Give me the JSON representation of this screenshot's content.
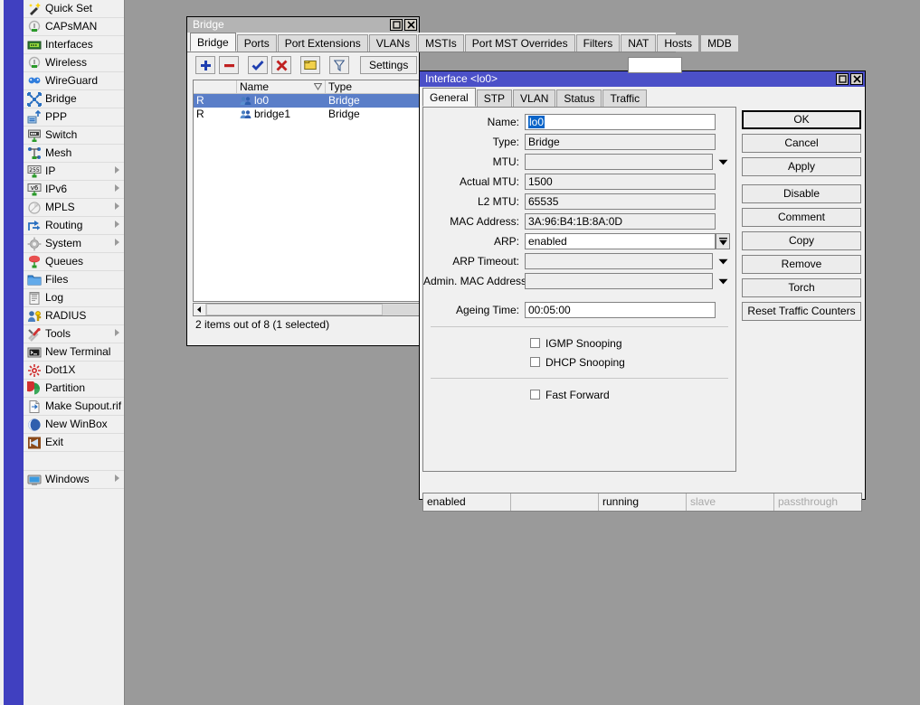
{
  "app": {
    "background_color": "#9a9a9a",
    "sidebar_stripe_color": "#4040c0",
    "accent_color": "#4b50c8"
  },
  "sidebar": {
    "items": [
      {
        "label": "Quick Set",
        "icon": "wand-icon",
        "submenu": false
      },
      {
        "label": "CAPsMAN",
        "icon": "antenna-icon",
        "submenu": false
      },
      {
        "label": "Interfaces",
        "icon": "nic-card-icon",
        "submenu": false
      },
      {
        "label": "Wireless",
        "icon": "antenna-icon",
        "submenu": false
      },
      {
        "label": "WireGuard",
        "icon": "wireguard-icon",
        "submenu": false
      },
      {
        "label": "Bridge",
        "icon": "bridge-icon",
        "submenu": false
      },
      {
        "label": "PPP",
        "icon": "ppp-icon",
        "submenu": false
      },
      {
        "label": "Switch",
        "icon": "switch-icon",
        "submenu": false
      },
      {
        "label": "Mesh",
        "icon": "mesh-icon",
        "submenu": false
      },
      {
        "label": "IP",
        "icon": "ip-255-icon",
        "submenu": true
      },
      {
        "label": "IPv6",
        "icon": "ipv6-icon",
        "submenu": true
      },
      {
        "label": "MPLS",
        "icon": "mpls-icon",
        "submenu": true
      },
      {
        "label": "Routing",
        "icon": "routing-icon",
        "submenu": true
      },
      {
        "label": "System",
        "icon": "gear-icon",
        "submenu": true
      },
      {
        "label": "Queues",
        "icon": "queues-icon",
        "submenu": false
      },
      {
        "label": "Files",
        "icon": "folder-icon",
        "submenu": false
      },
      {
        "label": "Log",
        "icon": "log-icon",
        "submenu": false
      },
      {
        "label": "RADIUS",
        "icon": "radius-key-icon",
        "submenu": false
      },
      {
        "label": "Tools",
        "icon": "tools-icon",
        "submenu": true
      },
      {
        "label": "New Terminal",
        "icon": "terminal-icon",
        "submenu": false
      },
      {
        "label": "Dot1X",
        "icon": "dot1x-icon",
        "submenu": false
      },
      {
        "label": "Partition",
        "icon": "partition-icon",
        "submenu": false
      },
      {
        "label": "Make Supout.rif",
        "icon": "document-icon",
        "submenu": false
      },
      {
        "label": "New WinBox",
        "icon": "winbox-icon",
        "submenu": false
      },
      {
        "label": "Exit",
        "icon": "exit-icon",
        "submenu": false
      }
    ],
    "footer_items": [
      {
        "label": "Windows",
        "icon": "monitor-icon",
        "submenu": true
      }
    ]
  },
  "bridge_window": {
    "title": "Bridge",
    "maximize_glyph": "❐",
    "close_glyph": "✕",
    "tabs": [
      {
        "label": "Bridge",
        "selected": true
      },
      {
        "label": "Ports",
        "selected": false
      },
      {
        "label": "Port Extensions",
        "selected": false
      },
      {
        "label": "VLANs",
        "selected": false
      },
      {
        "label": "MSTIs",
        "selected": false
      },
      {
        "label": "Port MST Overrides",
        "selected": false
      },
      {
        "label": "Filters",
        "selected": false
      },
      {
        "label": "NAT",
        "selected": false
      },
      {
        "label": "Hosts",
        "selected": false
      },
      {
        "label": "MDB",
        "selected": false
      }
    ],
    "toolbar": [
      {
        "name": "add-button",
        "icon": "plus-icon",
        "label": ""
      },
      {
        "name": "remove-button",
        "icon": "minus-icon",
        "label": ""
      },
      {
        "name": "enable-button",
        "icon": "check-icon",
        "label": ""
      },
      {
        "name": "disable-button",
        "icon": "x-red-icon",
        "label": ""
      },
      {
        "name": "comment-button",
        "icon": "note-icon",
        "label": ""
      },
      {
        "name": "filter-button",
        "icon": "funnel-icon",
        "label": ""
      },
      {
        "name": "settings-button",
        "icon": "",
        "label": "Settings"
      }
    ],
    "table": {
      "columns": [
        "",
        "Name",
        "Type"
      ],
      "sorted_column": "Name",
      "rows": [
        {
          "flag": "R",
          "name": "lo0",
          "type": "Bridge",
          "selected": true
        },
        {
          "flag": "R",
          "name": "bridge1",
          "type": "Bridge",
          "selected": false
        }
      ]
    },
    "status": "2 items out of 8 (1 selected)"
  },
  "interface_dialog": {
    "title": "Interface <lo0>",
    "maximize_glyph": "❐",
    "close_glyph": "✕",
    "tabs": [
      {
        "label": "General",
        "selected": true
      },
      {
        "label": "STP",
        "selected": false
      },
      {
        "label": "VLAN",
        "selected": false
      },
      {
        "label": "Status",
        "selected": false
      },
      {
        "label": "Traffic",
        "selected": false
      }
    ],
    "fields": [
      {
        "label": "Name:",
        "value": "lo0",
        "kind": "text-selected",
        "control": "none"
      },
      {
        "label": "Type:",
        "value": "Bridge",
        "kind": "readonly",
        "control": "none"
      },
      {
        "label": "MTU:",
        "value": "",
        "kind": "empty",
        "control": "arrow"
      },
      {
        "label": "Actual MTU:",
        "value": "1500",
        "kind": "readonly",
        "control": "none"
      },
      {
        "label": "L2 MTU:",
        "value": "65535",
        "kind": "readonly",
        "control": "none"
      },
      {
        "label": "MAC Address:",
        "value": "3A:96:B4:1B:8A:0D",
        "kind": "readonly",
        "control": "none"
      },
      {
        "label": "ARP:",
        "value": "enabled",
        "kind": "text",
        "control": "dropbtn"
      },
      {
        "label": "ARP Timeout:",
        "value": "",
        "kind": "empty",
        "control": "arrow"
      },
      {
        "label": "Admin. MAC Address:",
        "value": "",
        "kind": "empty",
        "control": "arrow"
      },
      {
        "label": "Ageing Time:",
        "value": "00:05:00",
        "kind": "text",
        "control": "none"
      }
    ],
    "checkbox_groups": [
      [
        {
          "label": "IGMP Snooping",
          "checked": false
        },
        {
          "label": "DHCP Snooping",
          "checked": false
        }
      ],
      [
        {
          "label": "Fast Forward",
          "checked": false
        }
      ]
    ],
    "buttons": [
      {
        "label": "OK",
        "primary": true,
        "gap": false
      },
      {
        "label": "Cancel",
        "primary": false,
        "gap": false
      },
      {
        "label": "Apply",
        "primary": false,
        "gap": false
      },
      {
        "label": "Disable",
        "primary": false,
        "gap": true
      },
      {
        "label": "Comment",
        "primary": false,
        "gap": false
      },
      {
        "label": "Copy",
        "primary": false,
        "gap": false
      },
      {
        "label": "Remove",
        "primary": false,
        "gap": false
      },
      {
        "label": "Torch",
        "primary": false,
        "gap": false
      },
      {
        "label": "Reset Traffic Counters",
        "primary": false,
        "gap": false
      }
    ],
    "status_cells": [
      {
        "text": "enabled",
        "dim": false
      },
      {
        "text": "",
        "dim": false
      },
      {
        "text": "running",
        "dim": false
      },
      {
        "text": "slave",
        "dim": true
      },
      {
        "text": "passthrough",
        "dim": true
      }
    ]
  }
}
